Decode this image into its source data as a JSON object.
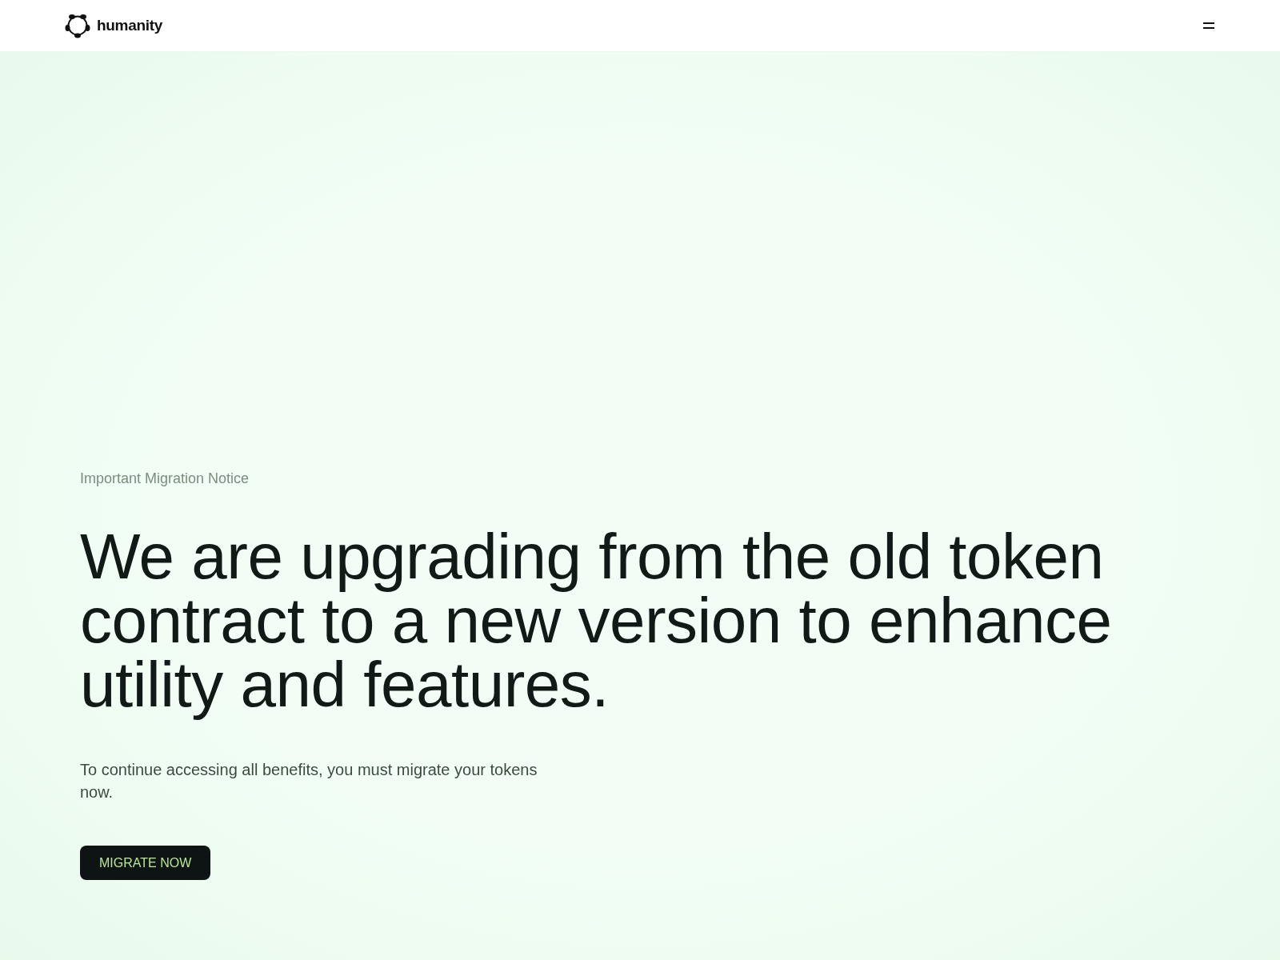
{
  "header": {
    "logo_text": "humanity"
  },
  "hero": {
    "eyebrow": "Important Migration Notice",
    "heading": "We are upgrading from the old token contract to a new version to enhance utility and features.",
    "body": "To continue accessing all benefits, you must migrate your tokens now.",
    "button": "MIGRATE NOW"
  }
}
